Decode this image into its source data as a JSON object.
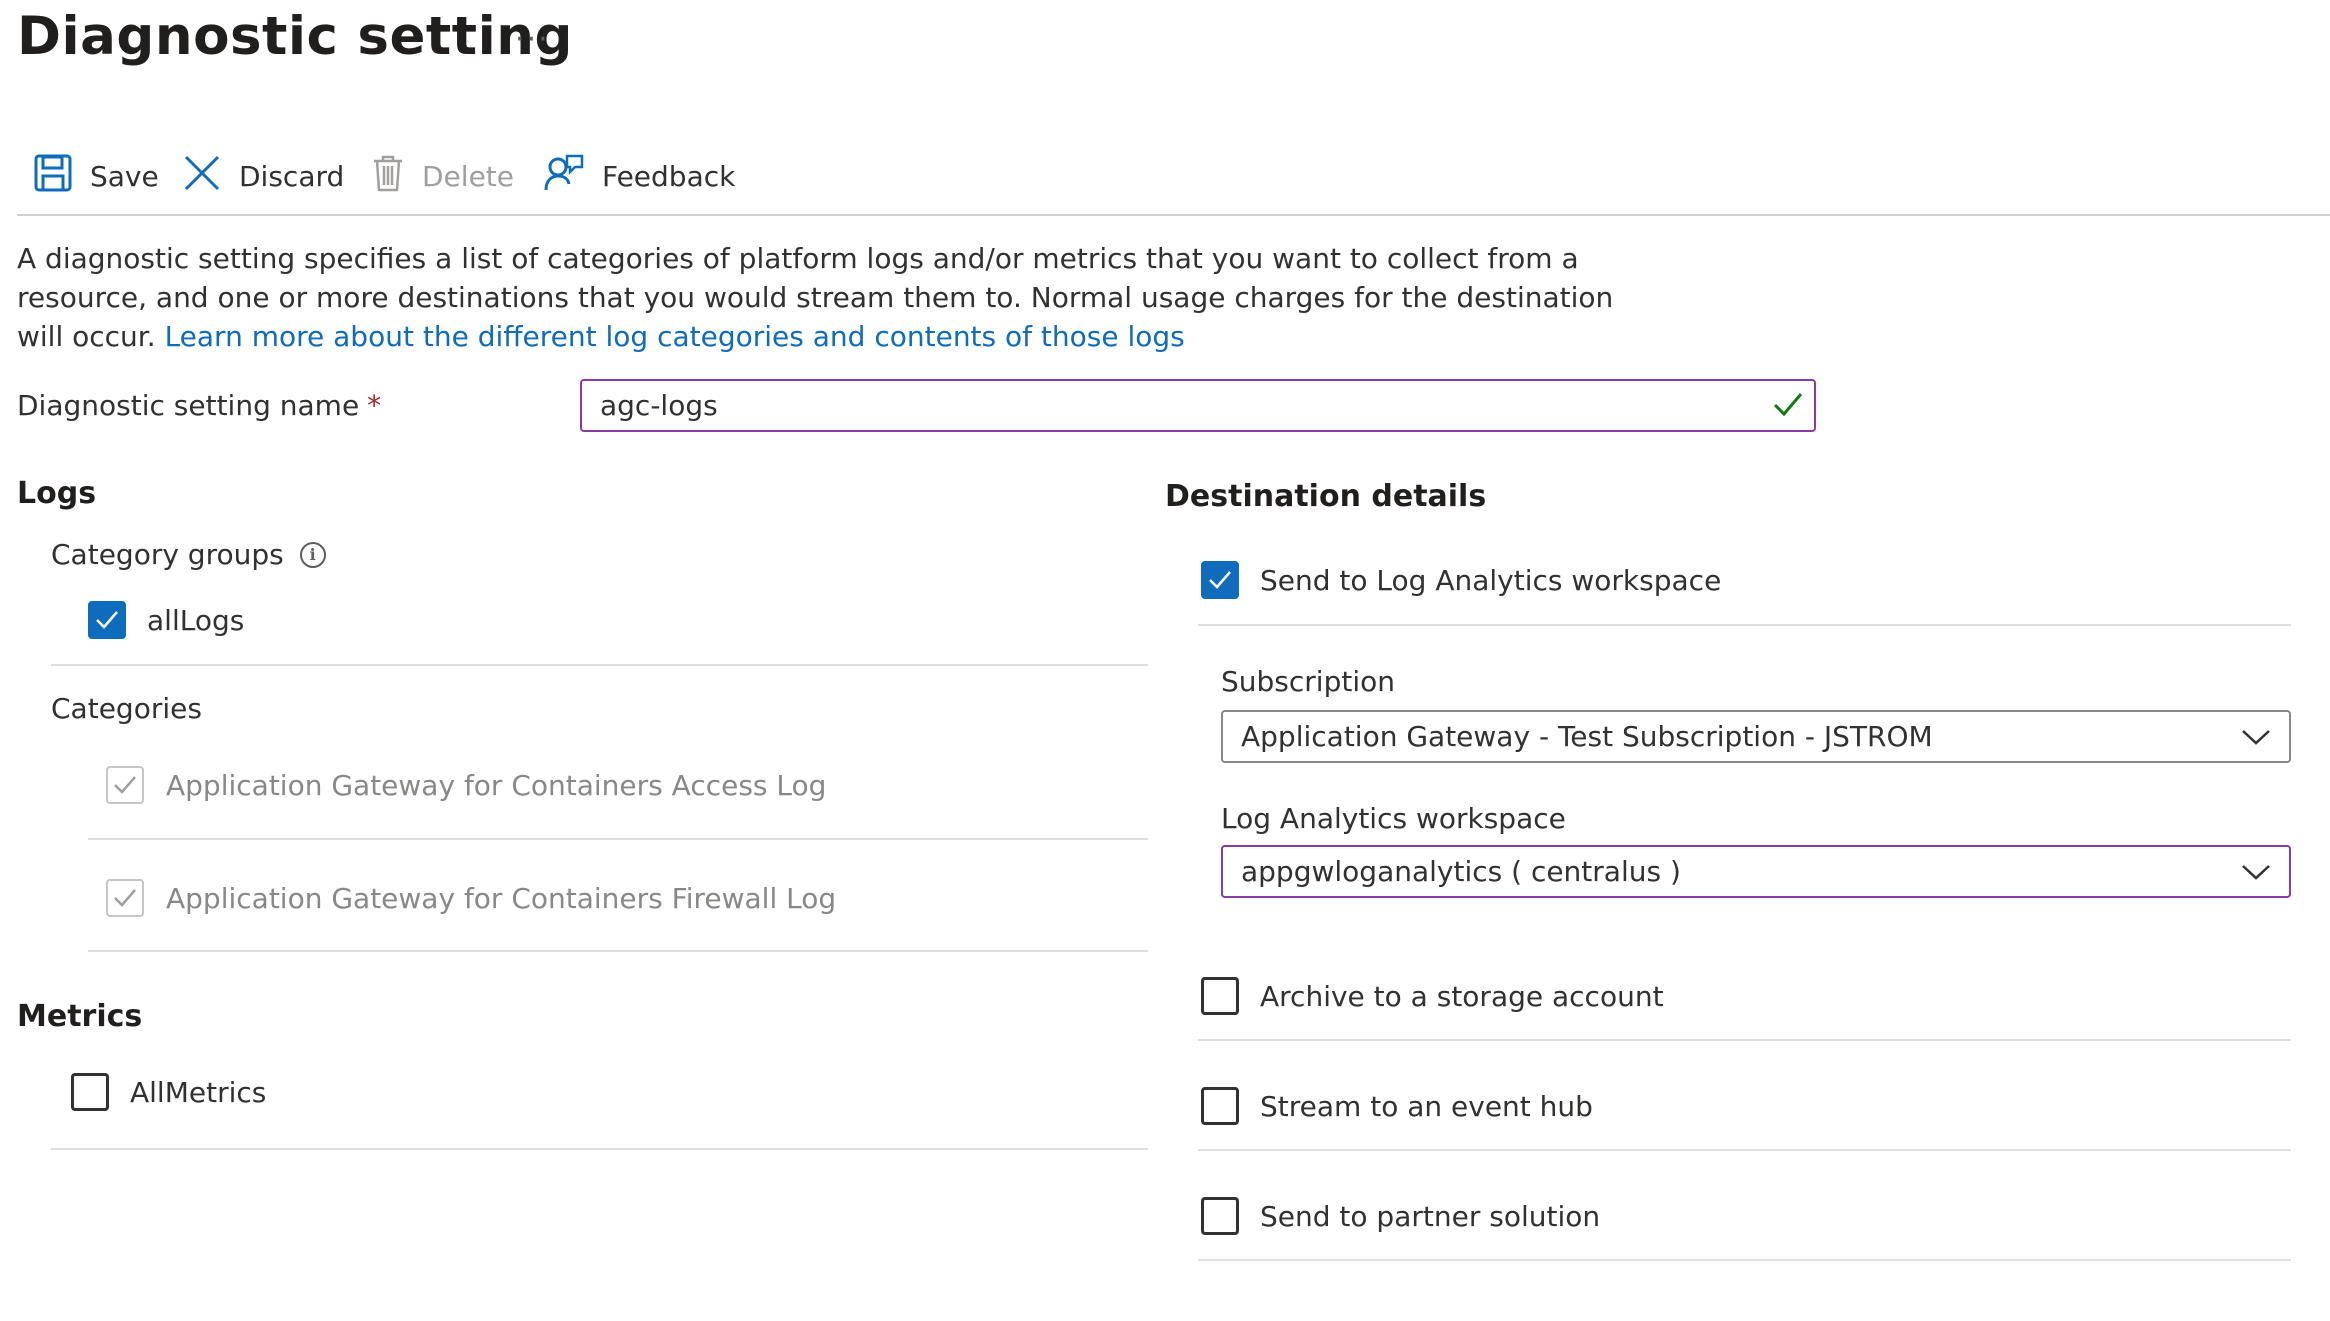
{
  "header": {
    "title": "Diagnostic setting",
    "more": "···"
  },
  "toolbar": {
    "save": "Save",
    "discard": "Discard",
    "delete": "Delete",
    "feedback": "Feedback"
  },
  "description": {
    "text": "A diagnostic setting specifies a list of categories of platform logs and/or metrics that you want to collect from a resource, and one or more destinations that you would stream them to. Normal usage charges for the destination will occur.",
    "link": "Learn more about the different log categories and contents of those logs"
  },
  "name_field": {
    "label": "Diagnostic setting name",
    "required_marker": "*",
    "value": "agc-logs"
  },
  "logs": {
    "heading": "Logs",
    "category_groups_label": "Category groups",
    "info_glyph": "i",
    "all_logs": {
      "label": "allLogs",
      "checked": true
    },
    "categories_label": "Categories",
    "categories": [
      {
        "label": "Application Gateway for Containers Access Log",
        "checked": true,
        "disabled": true
      },
      {
        "label": "Application Gateway for Containers Firewall Log",
        "checked": true,
        "disabled": true
      }
    ]
  },
  "metrics": {
    "heading": "Metrics",
    "all_metrics": {
      "label": "AllMetrics",
      "checked": false
    }
  },
  "destination": {
    "heading": "Destination details",
    "log_analytics": {
      "label": "Send to Log Analytics workspace",
      "checked": true
    },
    "subscription": {
      "label": "Subscription",
      "value": "Application Gateway - Test Subscription - JSTROM"
    },
    "workspace": {
      "label": "Log Analytics workspace",
      "value": "appgwloganalytics ( centralus )"
    },
    "storage": {
      "label": "Archive to a storage account",
      "checked": false
    },
    "event_hub": {
      "label": "Stream to an event hub",
      "checked": false
    },
    "partner": {
      "label": "Send to partner solution",
      "checked": false
    }
  },
  "colors": {
    "accent": "#0f6cbd",
    "focus_border": "#8a3aa8",
    "valid_check": "#107c10",
    "required": "#a4262c"
  }
}
